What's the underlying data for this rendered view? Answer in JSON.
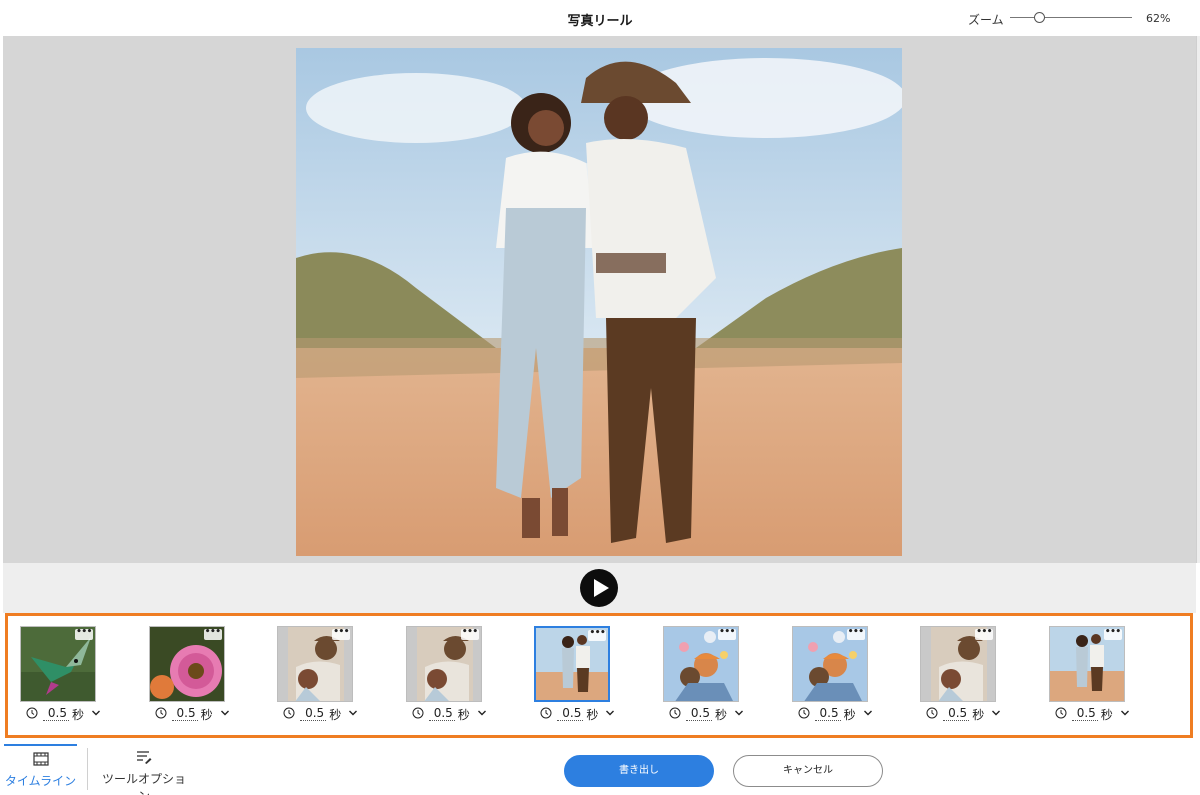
{
  "header": {
    "title": "写真リール",
    "zoom_label": "ズーム",
    "zoom_value": "62%",
    "zoom_level": 0.2
  },
  "preview": {
    "play_icon": "play-icon"
  },
  "filmstrip": {
    "more_label": "•••",
    "frames": [
      {
        "image": "hummingbird",
        "duration": "0.5",
        "unit": "秒",
        "selected": false
      },
      {
        "image": "pink-daisy",
        "duration": "0.5",
        "unit": "秒",
        "selected": false
      },
      {
        "image": "couple-selfie",
        "duration": "0.5",
        "unit": "秒",
        "selected": false
      },
      {
        "image": "couple-selfie",
        "duration": "0.5",
        "unit": "秒",
        "selected": false
      },
      {
        "image": "couple-walking",
        "duration": "0.5",
        "unit": "秒",
        "selected": true
      },
      {
        "image": "couple-balloons",
        "duration": "0.5",
        "unit": "秒",
        "selected": false
      },
      {
        "image": "couple-balloons",
        "duration": "0.5",
        "unit": "秒",
        "selected": false
      },
      {
        "image": "couple-selfie",
        "duration": "0.5",
        "unit": "秒",
        "selected": false
      },
      {
        "image": "couple-walking",
        "duration": "0.5",
        "unit": "秒",
        "selected": false
      }
    ]
  },
  "footer": {
    "tabs": [
      {
        "label": "タイムライン",
        "icon": "filmstrip-icon",
        "active": true
      },
      {
        "label": "ツールオプション",
        "icon": "tool-options-icon",
        "active": false
      }
    ],
    "export_label": "書き出し",
    "cancel_label": "キャンセル"
  },
  "colors": {
    "accent": "#2d7fe0",
    "filmstrip_border": "#ef7d22",
    "preview_bg": "#d6d6d6"
  }
}
